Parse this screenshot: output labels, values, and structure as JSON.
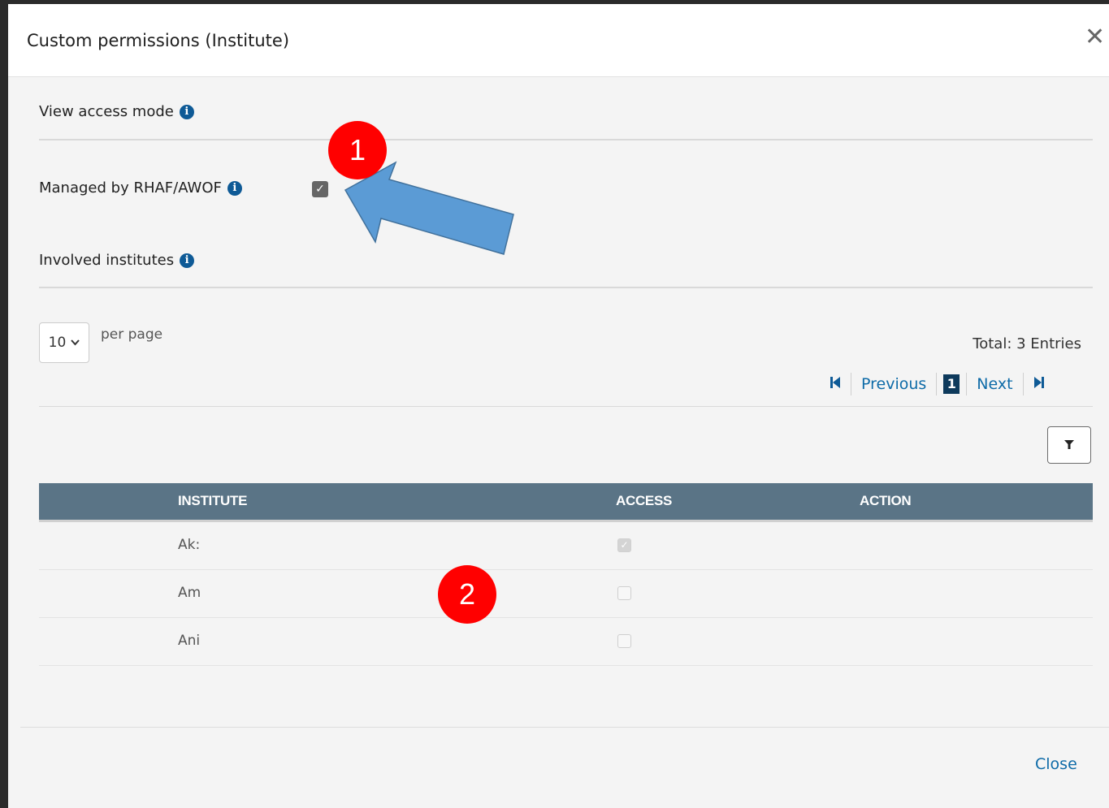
{
  "modal": {
    "title": "Custom permissions (Institute)",
    "close_glyph": "✕"
  },
  "sections": {
    "view_access_mode": "View access mode",
    "managed_by": "Managed by RHAF/AWOF",
    "managed_checked": true,
    "involved_institutes": "Involved institutes"
  },
  "icons": {
    "info": "info-icon",
    "close": "close-icon",
    "filter": "filter-icon",
    "first_page": "first-page-icon",
    "last_page": "last-page-icon"
  },
  "annotations": {
    "marker_1": "1",
    "marker_2": "2",
    "arrow_color": "#5b9bd5",
    "marker_color": "#ff0000"
  },
  "table_controls": {
    "per_page_value": "10",
    "per_page_label": "per page",
    "total": "Total: 3 Entries",
    "previous": "Previous",
    "current_page": "1",
    "next": "Next"
  },
  "table": {
    "columns": [
      "INSTITUTE",
      "ACCESS",
      "ACTION"
    ],
    "rows": [
      {
        "institute": "Ak:",
        "access": true
      },
      {
        "institute": "Am",
        "access": false
      },
      {
        "institute": "Ani",
        "access": false
      }
    ]
  },
  "footer": {
    "close_label": "Close"
  },
  "colors": {
    "header_bg": "#5a7486",
    "link": "#0e6ba8",
    "info_icon": "#0e5a96"
  }
}
